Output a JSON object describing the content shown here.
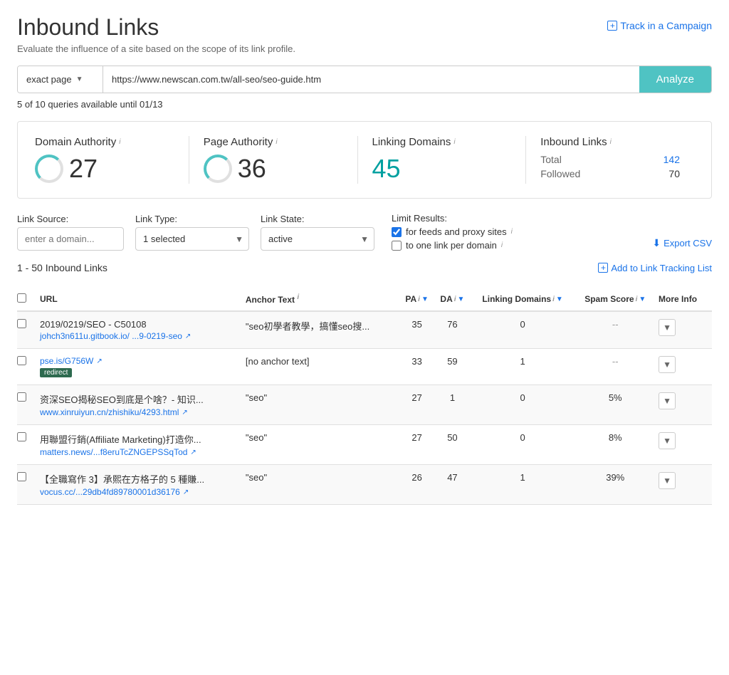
{
  "page": {
    "title": "Inbound Links",
    "subtitle": "Evaluate the influence of a site based on the scope of its link profile."
  },
  "header": {
    "track_campaign_label": "Track in a Campaign"
  },
  "search": {
    "page_type": "exact page",
    "url_value": "https://www.newscan.com.tw/all-seo/seo-guide.htm",
    "analyze_label": "Analyze",
    "queries_info": "5 of 10 queries available until 01/13"
  },
  "metrics": {
    "domain_authority": {
      "label": "Domain Authority",
      "value": "27"
    },
    "page_authority": {
      "label": "Page Authority",
      "value": "36"
    },
    "linking_domains": {
      "label": "Linking Domains",
      "value": "45"
    },
    "inbound_links": {
      "label": "Inbound Links",
      "total_label": "Total",
      "total_value": "142",
      "followed_label": "Followed",
      "followed_value": "70"
    }
  },
  "filters": {
    "link_source_label": "Link Source:",
    "link_source_placeholder": "enter a domain...",
    "link_type_label": "Link Type:",
    "link_type_value": "1 selected",
    "link_state_label": "Link State:",
    "link_state_value": "active",
    "limit_label": "Limit Results:",
    "checkbox1_label": "for feeds and proxy sites",
    "checkbox2_label": "to one link per domain",
    "export_label": "Export CSV"
  },
  "results": {
    "count_label": "1 - 50 Inbound Links",
    "add_tracking_label": "Add to Link Tracking List"
  },
  "table": {
    "headers": {
      "url": "URL",
      "anchor": "Anchor Text",
      "pa": "PA",
      "da": "DA",
      "linking_domains": "Linking Domains",
      "spam_score": "Spam Score",
      "more_info": "More Info"
    },
    "rows": [
      {
        "url_title": "2019/0219/SEO - C50108",
        "url_link": "johch3n611u.gitbook.io/ ...9-0219-seo",
        "redirect": false,
        "anchor": "\"seo初學者教學，搞懂seo搜...",
        "pa": "35",
        "da": "76",
        "linking_domains": "0",
        "spam_score": "--",
        "has_expand": true
      },
      {
        "url_title": "",
        "url_link": "pse.is/G756W",
        "redirect": true,
        "anchor": "[no anchor text]",
        "pa": "33",
        "da": "59",
        "linking_domains": "1",
        "spam_score": "--",
        "has_expand": true
      },
      {
        "url_title": "资深SEO揭秘SEO到底是个啥？- 知识...",
        "url_link": "www.xinruiyun.cn/zhishiku/4293.html",
        "redirect": false,
        "anchor": "\"seo\"",
        "pa": "27",
        "da": "1",
        "linking_domains": "0",
        "spam_score": "5%",
        "has_expand": true
      },
      {
        "url_title": "用聯盟行銷(Affiliate Marketing)打造你...",
        "url_link": "matters.news/...f8eruTcZNGEPSSqTod",
        "redirect": false,
        "anchor": "\"seo\"",
        "pa": "27",
        "da": "50",
        "linking_domains": "0",
        "spam_score": "8%",
        "has_expand": true
      },
      {
        "url_title": "【全職寫作 3】承熙在方格子的 5 種賺...",
        "url_link": "vocus.cc/...29db4fd89780001d36176",
        "redirect": false,
        "anchor": "\"seo\"",
        "pa": "26",
        "da": "47",
        "linking_domains": "1",
        "spam_score": "39%",
        "has_expand": true
      }
    ]
  }
}
